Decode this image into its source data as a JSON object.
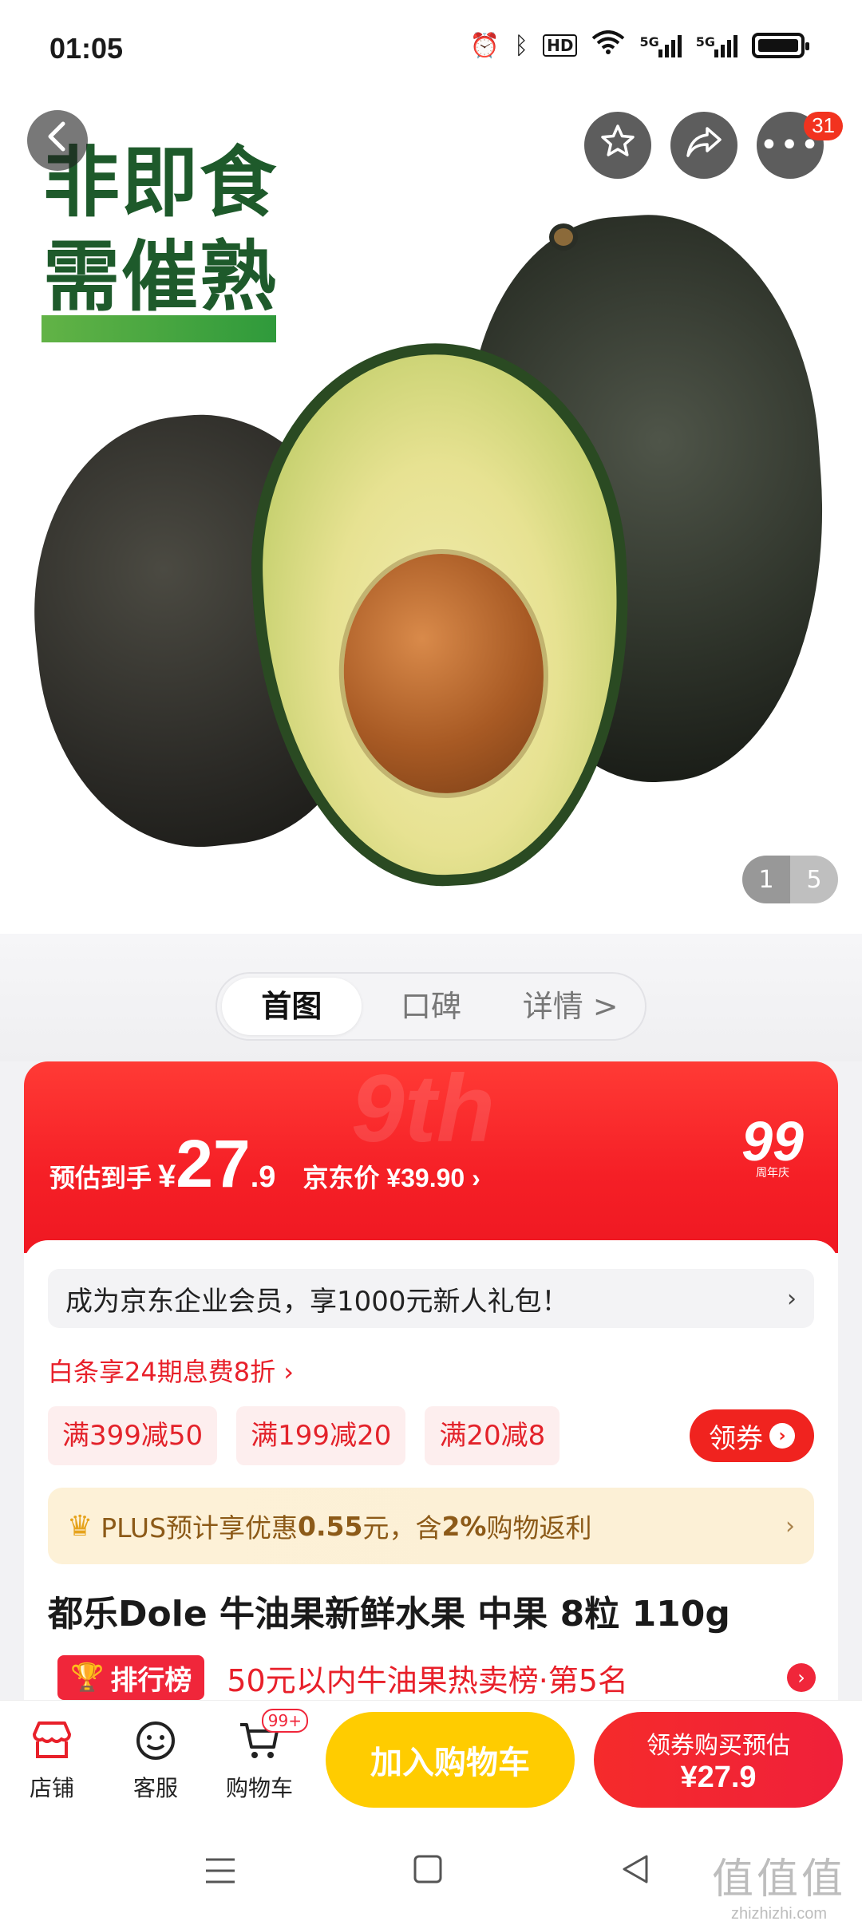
{
  "status": {
    "time": "01:05"
  },
  "header": {
    "notification_count": "31"
  },
  "hero": {
    "headline_line1": "非即食",
    "headline_line2": "需催熟",
    "image_current": "1",
    "image_total": "5"
  },
  "tabs": [
    {
      "label": "首图"
    },
    {
      "label": "口碑"
    },
    {
      "label": "详情 >"
    }
  ],
  "price": {
    "label": "预估到手",
    "currency": "¥",
    "integer": "27",
    "decimal": ".9",
    "jd_price": "京东价 ¥39.90",
    "promo_logo_text": "99",
    "promo_logo_sub": "周年庆"
  },
  "member": {
    "text": "成为京东企业会员，享1000元新人礼包！"
  },
  "baitiao": {
    "text": "白条享24期息费8折"
  },
  "coupons": [
    {
      "label": "满399减50"
    },
    {
      "label": "满199减20"
    },
    {
      "label": "满20减8"
    }
  ],
  "get_coupon_label": "领券",
  "plus": {
    "prefix": "PLUS预计享优惠",
    "amount": "0.55",
    "middle": "元，含",
    "rate": "2%",
    "suffix": "购物返利"
  },
  "product": {
    "title": "都乐Dole 牛油果新鲜水果 中果 8粒 110g"
  },
  "ranking": {
    "badge": "排行榜",
    "text": "50元以内牛油果热卖榜·第5名"
  },
  "bottom_bar": {
    "shop": "店铺",
    "service": "客服",
    "cart": "购物车",
    "cart_badge": "99+",
    "add_to_cart": "加入购物车",
    "buy_line1": "领券购买预估",
    "buy_line2": "¥27.9"
  },
  "watermark": {
    "line1": "值值值",
    "line2": "zhizhizhi.com"
  },
  "colors": {
    "accent_red": "#f0231f",
    "add_cart_yellow": "#ffcc00",
    "hero_green": "#1e5a2b"
  }
}
